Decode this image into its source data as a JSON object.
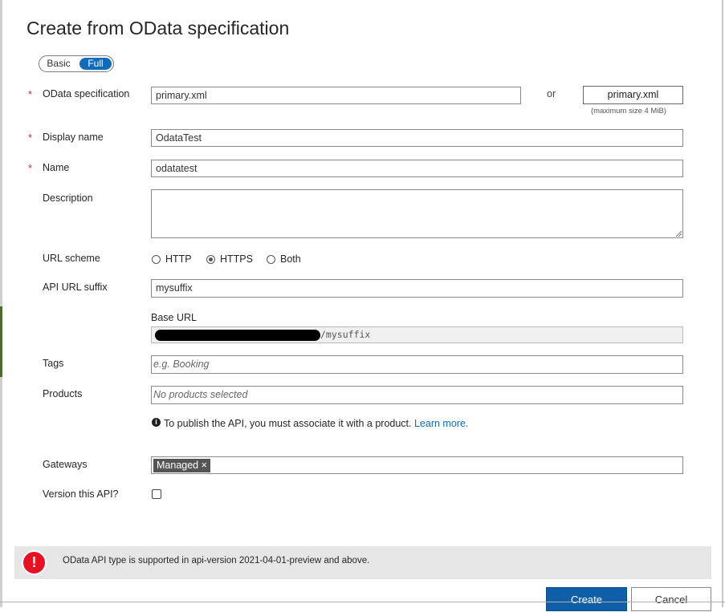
{
  "dialog": {
    "title": "Create from OData specification"
  },
  "mode_toggle": {
    "options": [
      "Basic",
      "Full"
    ],
    "selected": "Full"
  },
  "form": {
    "odata_spec": {
      "label": "OData specification",
      "required_marker": "*",
      "value": "primary.xml",
      "or_text": "or",
      "file_button_label": "primary.xml",
      "max_size_note": "(maximum size 4 MiB)"
    },
    "display_name": {
      "label": "Display name",
      "required_marker": "*",
      "value": "OdataTest"
    },
    "name": {
      "label": "Name",
      "required_marker": "*",
      "value": "odatatest"
    },
    "description": {
      "label": "Description",
      "value": ""
    },
    "url_scheme": {
      "label": "URL scheme",
      "options": [
        "HTTP",
        "HTTPS",
        "Both"
      ],
      "selected": "HTTPS"
    },
    "api_url_suffix": {
      "label": "API URL suffix",
      "value": "mysuffix"
    },
    "base_url": {
      "label": "Base URL",
      "value_suffix": "/mysuffix"
    },
    "tags": {
      "label": "Tags",
      "placeholder": "e.g. Booking"
    },
    "products": {
      "label": "Products",
      "placeholder": "No products selected",
      "info_text": "To publish the API, you must associate it with a product.",
      "learn_more": "Learn more."
    },
    "gateways": {
      "label": "Gateways",
      "chips": [
        "Managed"
      ]
    },
    "version": {
      "label": "Version this API?",
      "checked": false
    }
  },
  "banner": {
    "message": "OData API type is supported in api-version 2021-04-01-preview and above.",
    "icon": "error-icon"
  },
  "buttons": {
    "create": "Create",
    "cancel": "Cancel"
  },
  "colors": {
    "accent": "#0f6cbd",
    "primary_button": "#0f5fa8",
    "required": "#c4314b",
    "error": "#e81123",
    "banner_bg": "#e6e6e6",
    "chip_bg": "#555555"
  }
}
